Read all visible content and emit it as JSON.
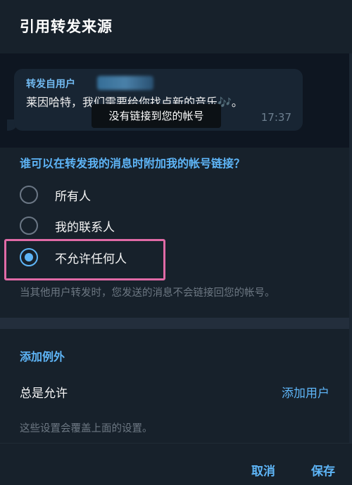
{
  "dialog": {
    "title": "引用转发来源"
  },
  "preview": {
    "forwarded_label": "转发自用户",
    "message": "莱因哈特，我们需要给你找点新的音乐🎶。",
    "time": "17:37",
    "tooltip": "没有链接到您的帐号"
  },
  "privacy": {
    "question": "谁可以在转发我的消息时附加我的帐号链接？",
    "options": [
      {
        "label": "所有人",
        "checked": false
      },
      {
        "label": "我的联系人",
        "checked": false
      },
      {
        "label": "不允许任何人",
        "checked": true
      }
    ],
    "hint": "当其他用户转发时，您发送的消息不会链接回您的帐号。"
  },
  "exceptions": {
    "title": "添加例外",
    "always_allow_label": "总是允许",
    "add_users_label": "添加用户",
    "hint": "这些设置会覆盖上面的设置。"
  },
  "footer": {
    "cancel_label": "取消",
    "save_label": "保存"
  },
  "colors": {
    "background": "#17212b",
    "accent": "#5eb5f7",
    "highlight": "#e06aa6"
  }
}
